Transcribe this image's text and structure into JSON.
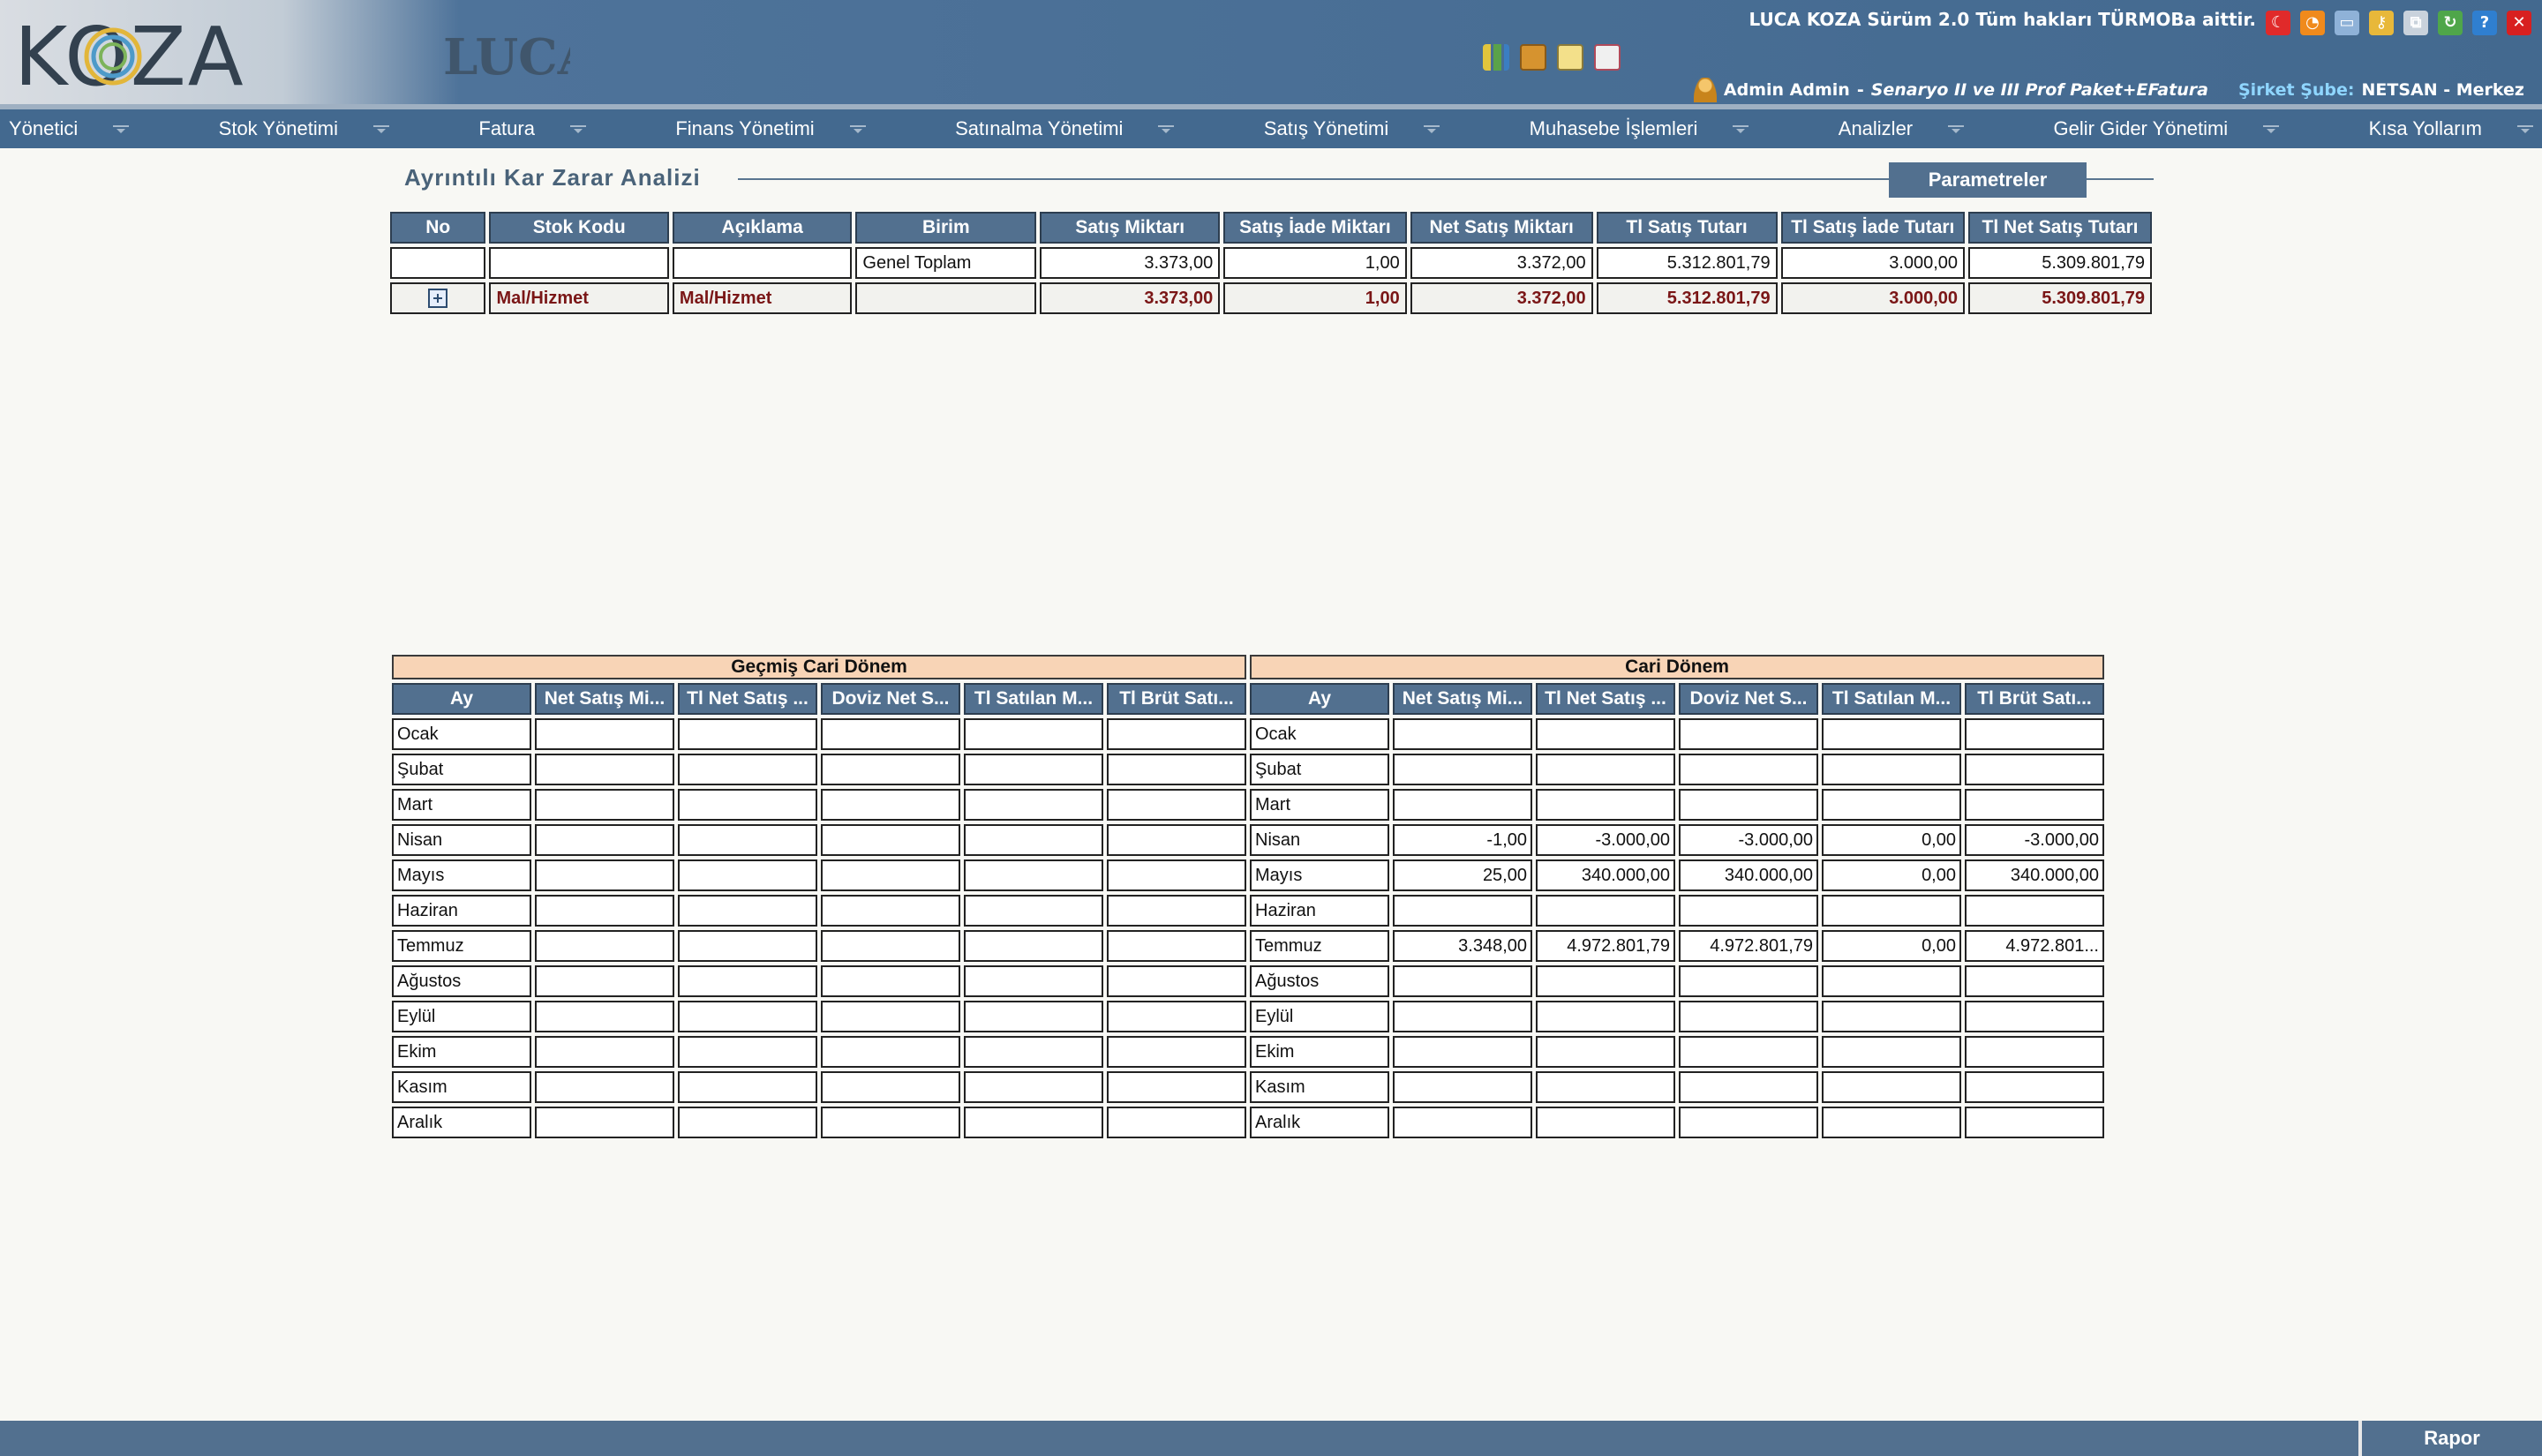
{
  "header": {
    "logo_text": "KOZA",
    "brand_text": "LUCA",
    "version_text": "LUCA KOZA Sürüm 2.0 Tüm hakları TÜRMOBa aittir.",
    "user_name": "Admin Admin",
    "separator": " - ",
    "scenario": "Senaryo II ve III Prof Paket+EFatura",
    "branch_label": "Şirket Şube:",
    "branch_value": "NETSAN - Merkez",
    "tool_icons": [
      "chart-icon",
      "box-icon",
      "document-image-icon",
      "presentation-icon"
    ],
    "window_icons": [
      "flag-tr-icon",
      "rss-icon",
      "window-icon",
      "key-icon",
      "copy-icon",
      "refresh-icon",
      "help-icon",
      "close-icon"
    ]
  },
  "nav": [
    "Yönetici",
    "Stok Yönetimi",
    "Fatura",
    "Finans Yönetimi",
    "Satınalma Yönetimi",
    "Satış Yönetimi",
    "Muhasebe İşlemleri",
    "Analizler",
    "Gelir Gider Yönetimi",
    "Kısa Yollarım"
  ],
  "page": {
    "title": "Ayrıntılı Kar Zarar Analizi",
    "param_button": "Parametreler"
  },
  "grid": {
    "columns": [
      "No",
      "Stok Kodu",
      "Açıklama",
      "Birim",
      "Satış Miktarı",
      "Satış İade Miktarı",
      "Net Satış Miktarı",
      "Tl Satış Tutarı",
      "Tl Satış İade Tutarı",
      "Tl Net Satış Tutarı"
    ],
    "total_row": [
      "",
      "",
      "",
      "Genel Toplam",
      "3.373,00",
      "1,00",
      "3.372,00",
      "5.312.801,79",
      "3.000,00",
      "5.309.801,79"
    ],
    "group_row": [
      "",
      "Mal/Hizmet",
      "Mal/Hizmet",
      "",
      "3.373,00",
      "1,00",
      "3.372,00",
      "5.312.801,79",
      "3.000,00",
      "5.309.801,79"
    ]
  },
  "monthly": {
    "past_title": "Geçmiş Cari Dönem",
    "current_title": "Cari Dönem",
    "columns": [
      "Ay",
      "Net Satış Mi...",
      "Tl Net Satış ...",
      "Doviz Net S...",
      "Tl Satılan M...",
      "Tl Brüt Satı..."
    ],
    "months": [
      "Ocak",
      "Şubat",
      "Mart",
      "Nisan",
      "Mayıs",
      "Haziran",
      "Temmuz",
      "Ağustos",
      "Eylül",
      "Ekim",
      "Kasım",
      "Aralık"
    ],
    "past_values": [
      [
        "",
        "",
        "",
        "",
        ""
      ],
      [
        "",
        "",
        "",
        "",
        ""
      ],
      [
        "",
        "",
        "",
        "",
        ""
      ],
      [
        "",
        "",
        "",
        "",
        ""
      ],
      [
        "",
        "",
        "",
        "",
        ""
      ],
      [
        "",
        "",
        "",
        "",
        ""
      ],
      [
        "",
        "",
        "",
        "",
        ""
      ],
      [
        "",
        "",
        "",
        "",
        ""
      ],
      [
        "",
        "",
        "",
        "",
        ""
      ],
      [
        "",
        "",
        "",
        "",
        ""
      ],
      [
        "",
        "",
        "",
        "",
        ""
      ],
      [
        "",
        "",
        "",
        "",
        ""
      ]
    ],
    "current_values": [
      [
        "",
        "",
        "",
        "",
        ""
      ],
      [
        "",
        "",
        "",
        "",
        ""
      ],
      [
        "",
        "",
        "",
        "",
        ""
      ],
      [
        "-1,00",
        "-3.000,00",
        "-3.000,00",
        "0,00",
        "-3.000,00"
      ],
      [
        "25,00",
        "340.000,00",
        "340.000,00",
        "0,00",
        "340.000,00"
      ],
      [
        "",
        "",
        "",
        "",
        ""
      ],
      [
        "3.348,00",
        "4.972.801,79",
        "4.972.801,79",
        "0,00",
        "4.972.801..."
      ],
      [
        "",
        "",
        "",
        "",
        ""
      ],
      [
        "",
        "",
        "",
        "",
        ""
      ],
      [
        "",
        "",
        "",
        "",
        ""
      ],
      [
        "",
        "",
        "",
        "",
        ""
      ],
      [
        "",
        "",
        "",
        "",
        ""
      ]
    ]
  },
  "footer": {
    "report_button": "Rapor"
  },
  "colors": {
    "nav_bg": "#43698f",
    "header_cell": "#52708f",
    "period_header": "#f8d4b6",
    "group_text": "#7a1616"
  }
}
